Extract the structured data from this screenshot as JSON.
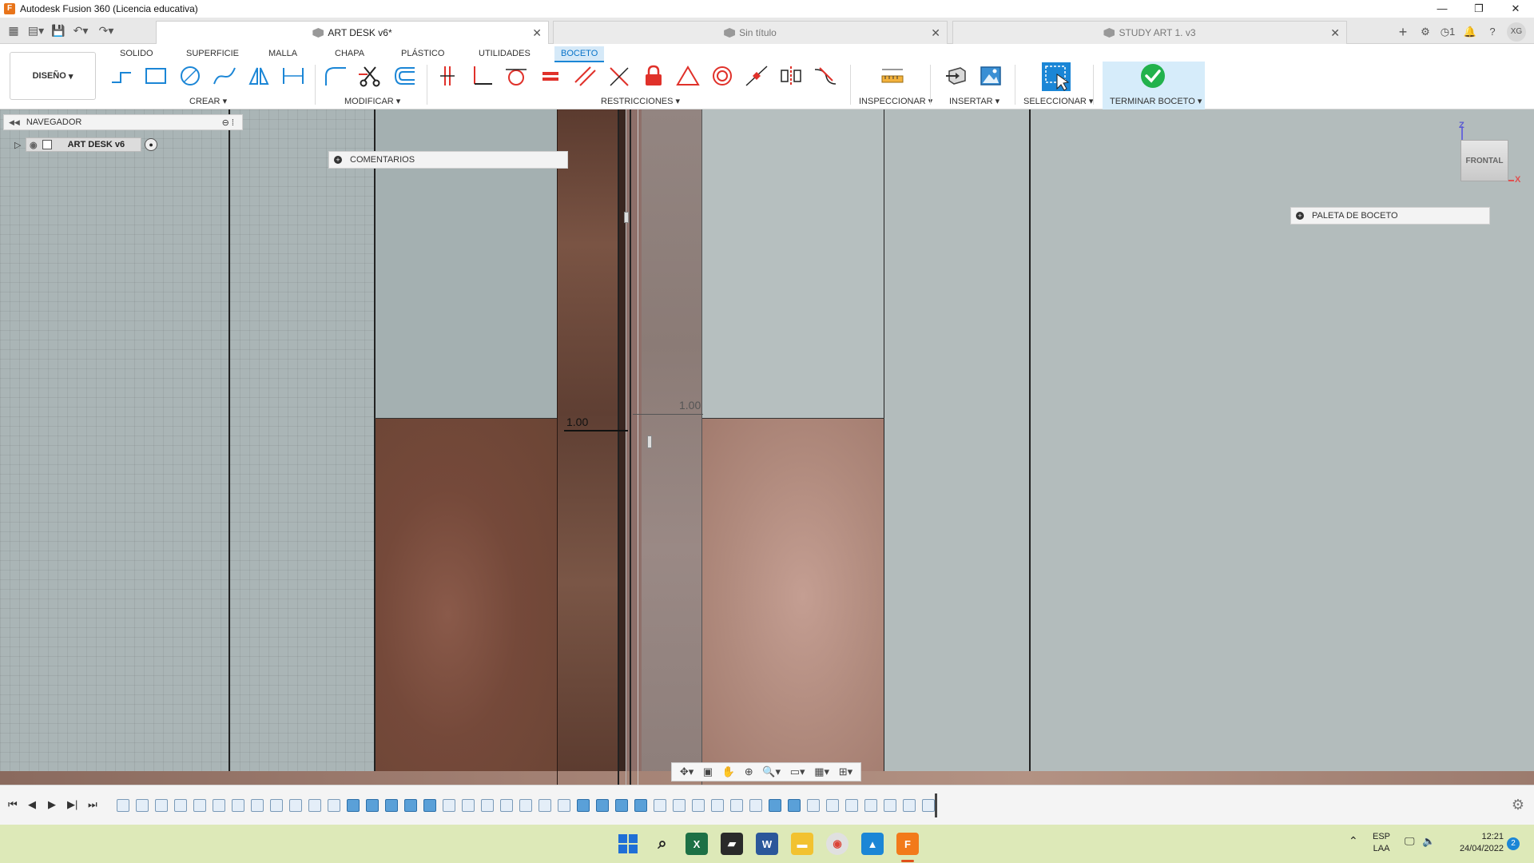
{
  "window": {
    "title": "Autodesk Fusion 360 (Licencia educativa)",
    "controls": [
      "—",
      "❐",
      "✕"
    ]
  },
  "tabs": [
    {
      "label": "ART DESK v6*",
      "active": true
    },
    {
      "label": "Sin título",
      "active": false
    },
    {
      "label": "STUDY ART 1. v3",
      "active": false
    }
  ],
  "header_right": {
    "jobs_count": "1",
    "avatar": "XG"
  },
  "ribbon": {
    "workspace": "DISEÑO",
    "menu_tabs": [
      "SOLIDO",
      "SUPERFICIE",
      "MALLA",
      "CHAPA",
      "PLÁSTICO",
      "UTILIDADES",
      "BOCETO"
    ],
    "active_menu_tab": "BOCETO",
    "groups": {
      "create": "CREAR",
      "modify": "MODIFICAR",
      "constraints": "RESTRICCIONES",
      "inspect": "INSPECCIONAR",
      "insert": "INSERTAR",
      "select": "SELECCIONAR",
      "finish": "TERMINAR BOCETO"
    }
  },
  "navigator": {
    "title": "NAVEGADOR",
    "root_item": "ART DESK v6"
  },
  "panels": {
    "comments": "COMENTARIOS",
    "sketch_palette": "PALETA DE BOCETO"
  },
  "viewcube": {
    "face": "FRONTAL",
    "axis_z": "Z",
    "axis_x": "X"
  },
  "dimensions": {
    "left": "1.00",
    "right": "1.00"
  },
  "taskbar": {
    "lang_top": "ESP",
    "lang_bottom": "LAA",
    "time": "12:21",
    "date": "24/04/2022",
    "notifications": "2"
  },
  "colors": {
    "accent": "#1b86d6",
    "canvas_bg": "#aab5b6",
    "wood_dark": "#6b4535",
    "wood_light": "#b08a7d",
    "finish_green": "#22b24c",
    "taskbar_bg": "#dde9b8"
  }
}
